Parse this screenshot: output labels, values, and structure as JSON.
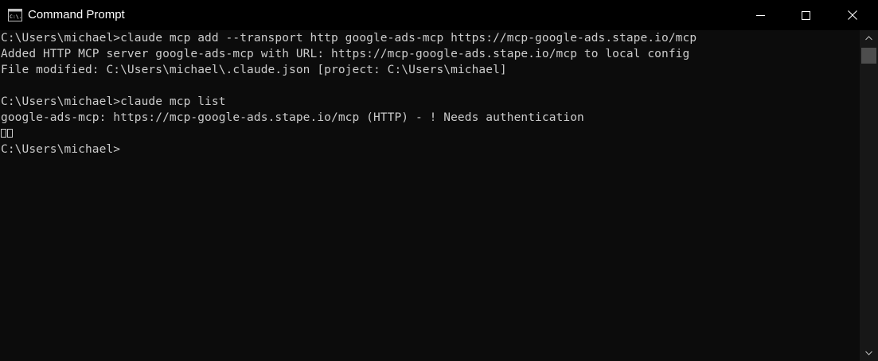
{
  "window": {
    "title": "Command Prompt",
    "app_icon": "cmd-icon",
    "icon_label": "C:\\."
  },
  "controls": {
    "minimize_icon": "minimize-icon",
    "maximize_icon": "maximize-icon",
    "close_icon": "close-icon"
  },
  "console": {
    "lines": [
      "C:\\Users\\michael>claude mcp add --transport http google-ads-mcp https://mcp-google-ads.stape.io/mcp",
      "Added HTTP MCP server google-ads-mcp with URL: https://mcp-google-ads.stape.io/mcp to local config",
      "File modified: C:\\Users\\michael\\.claude.json [project: C:\\Users\\michael]",
      "",
      "C:\\Users\\michael>claude mcp list",
      "google-ads-mcp: https://mcp-google-ads.stape.io/mcp (HTTP) - ! Needs authentication",
      "",
      "C:\\Users\\michael>"
    ]
  },
  "colors": {
    "background": "#0c0c0c",
    "titlebar": "#000000",
    "text": "#cccccc"
  }
}
